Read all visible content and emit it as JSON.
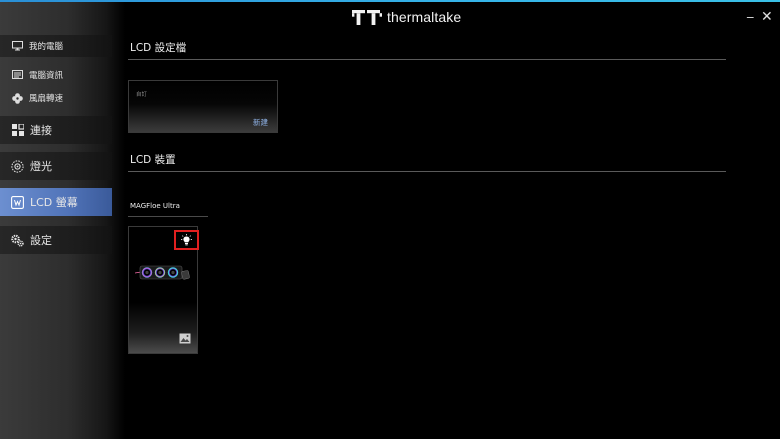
{
  "app": {
    "logo_text": "thermaltake"
  },
  "window": {
    "minimize_glyph": "_",
    "close_glyph": "✕"
  },
  "sidebar": {
    "items": [
      {
        "label": "我的電腦",
        "icon": "monitor-icon"
      },
      {
        "label": "電腦資訊",
        "icon": "info-panel-icon"
      },
      {
        "label": "風扇轉速",
        "icon": "fan-icon"
      },
      {
        "label": "連接",
        "icon": "connect-tiles-icon"
      },
      {
        "label": "燈光",
        "icon": "lighting-icon"
      },
      {
        "label": "LCD 螢幕",
        "icon": "lcd-screen-icon",
        "active": true
      },
      {
        "label": "設定",
        "icon": "gears-icon"
      }
    ]
  },
  "main": {
    "profile_section": {
      "title": "LCD 設定檔",
      "card": {
        "name": "自訂",
        "new_label": "新建"
      }
    },
    "device_section": {
      "title": "LCD 裝置",
      "device_tab": "MAGFloe Ultra"
    }
  },
  "colors": {
    "accent_bar": "#36b4e8",
    "active_nav": "#5174b9",
    "new_link": "#8fb2e6",
    "highlight_box": "#e02020"
  }
}
